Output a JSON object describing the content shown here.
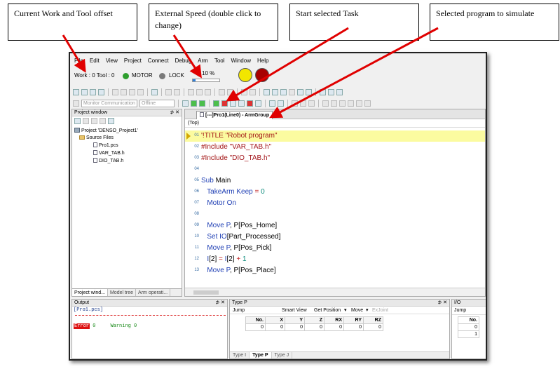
{
  "callouts": {
    "work_tool": "Current Work and Tool offset",
    "external_speed": "External Speed (double click to change)",
    "start_task": "Start selected Task",
    "selected_program": "Selected program to simulate"
  },
  "menu": [
    "File",
    "Edit",
    "View",
    "Project",
    "Connect",
    "Debug",
    "Arm",
    "Tool",
    "Window",
    "Help"
  ],
  "status": {
    "work_tool": "Work : 0  Tool : 0",
    "motor_label": "MOTOR",
    "lock_label": "LOCK",
    "speed_text": "10 %",
    "speed_percent": 10,
    "motor_color": "#2e9e2e",
    "lock_color": "#7a7a7a",
    "yellow_button": "#f2e600",
    "red_button": "#a80000"
  },
  "toolbar2": {
    "monitor_label": "Monitor Communication",
    "offline_value": "Offline"
  },
  "project_window": {
    "title": "Project window",
    "project": "Project 'DENSO_Project1'",
    "folder": "Source Files",
    "files": [
      "Pro1.pcs",
      "VAR_TAB.h",
      "DIO_TAB.h"
    ],
    "tabs": [
      "Project wind...",
      "Model tree",
      "Arm operati..."
    ]
  },
  "editor": {
    "tab_title": "[---]Pro1(Line0) - ArmGroup",
    "scope": "(Top)",
    "lines": [
      {
        "n": "01",
        "tokens": [
          {
            "t": "'!TITLE \"Robot program\"",
            "c": "pp"
          }
        ],
        "hl": true
      },
      {
        "n": "02",
        "tokens": [
          {
            "t": "#Include ",
            "c": "pp"
          },
          {
            "t": "\"VAR_TAB.h\"",
            "c": "str"
          }
        ]
      },
      {
        "n": "03",
        "tokens": [
          {
            "t": "#Include ",
            "c": "pp"
          },
          {
            "t": "\"DIO_TAB.h\"",
            "c": "str"
          }
        ]
      },
      {
        "n": "04",
        "tokens": []
      },
      {
        "n": "05",
        "tokens": [
          {
            "t": "Sub ",
            "c": "kw"
          },
          {
            "t": "Main",
            "c": "id"
          }
        ]
      },
      {
        "n": "06",
        "tokens": [
          {
            "t": "   TakeArm Keep ",
            "c": "kw"
          },
          {
            "t": "= ",
            "c": "op"
          },
          {
            "t": "0",
            "c": "num"
          }
        ]
      },
      {
        "n": "07",
        "tokens": [
          {
            "t": "   Motor On",
            "c": "kw"
          }
        ]
      },
      {
        "n": "08",
        "tokens": []
      },
      {
        "n": "09",
        "tokens": [
          {
            "t": "   Move P",
            "c": "kw"
          },
          {
            "t": ", P[Pos_Home]",
            "c": "id"
          }
        ]
      },
      {
        "n": "10",
        "tokens": [
          {
            "t": "   Set IO",
            "c": "kw"
          },
          {
            "t": "[Part_Processed]",
            "c": "id"
          }
        ]
      },
      {
        "n": "11",
        "tokens": [
          {
            "t": "   Move P",
            "c": "kw"
          },
          {
            "t": ", P[Pos_Pick]",
            "c": "id"
          }
        ]
      },
      {
        "n": "12",
        "tokens": [
          {
            "t": "   I",
            "c": "kw"
          },
          {
            "t": "[2] ",
            "c": "id"
          },
          {
            "t": "= ",
            "c": "op"
          },
          {
            "t": "I",
            "c": "kw"
          },
          {
            "t": "[2] ",
            "c": "id"
          },
          {
            "t": "+ ",
            "c": "op"
          },
          {
            "t": "1",
            "c": "num"
          }
        ]
      },
      {
        "n": "13",
        "tokens": [
          {
            "t": "   Move P",
            "c": "kw"
          },
          {
            "t": ", P[Pos_Place]",
            "c": "id"
          }
        ]
      }
    ]
  },
  "output": {
    "title": "Output",
    "line1": "[Pro1.pcs]",
    "error_label": "Error",
    "error_count": "0",
    "warning_text": "Warning 0"
  },
  "typep": {
    "title": "Type P",
    "jump": "Jump",
    "smart_view": "Smart View",
    "get_position": "Get Position",
    "move": "Move",
    "exjoint": "ExJoint",
    "columns": [
      "No.",
      "X",
      "Y",
      "Z",
      "RX",
      "RY",
      "RZ"
    ],
    "row": [
      "0",
      "0",
      "0",
      "0",
      "0",
      "0",
      "0"
    ],
    "tabs": [
      "Type I",
      "Type P",
      "Type J"
    ]
  },
  "io": {
    "title": "I/O",
    "jump": "Jump",
    "col": "No.",
    "rows": [
      "0",
      "1"
    ]
  },
  "arrow_color": "#e00000"
}
